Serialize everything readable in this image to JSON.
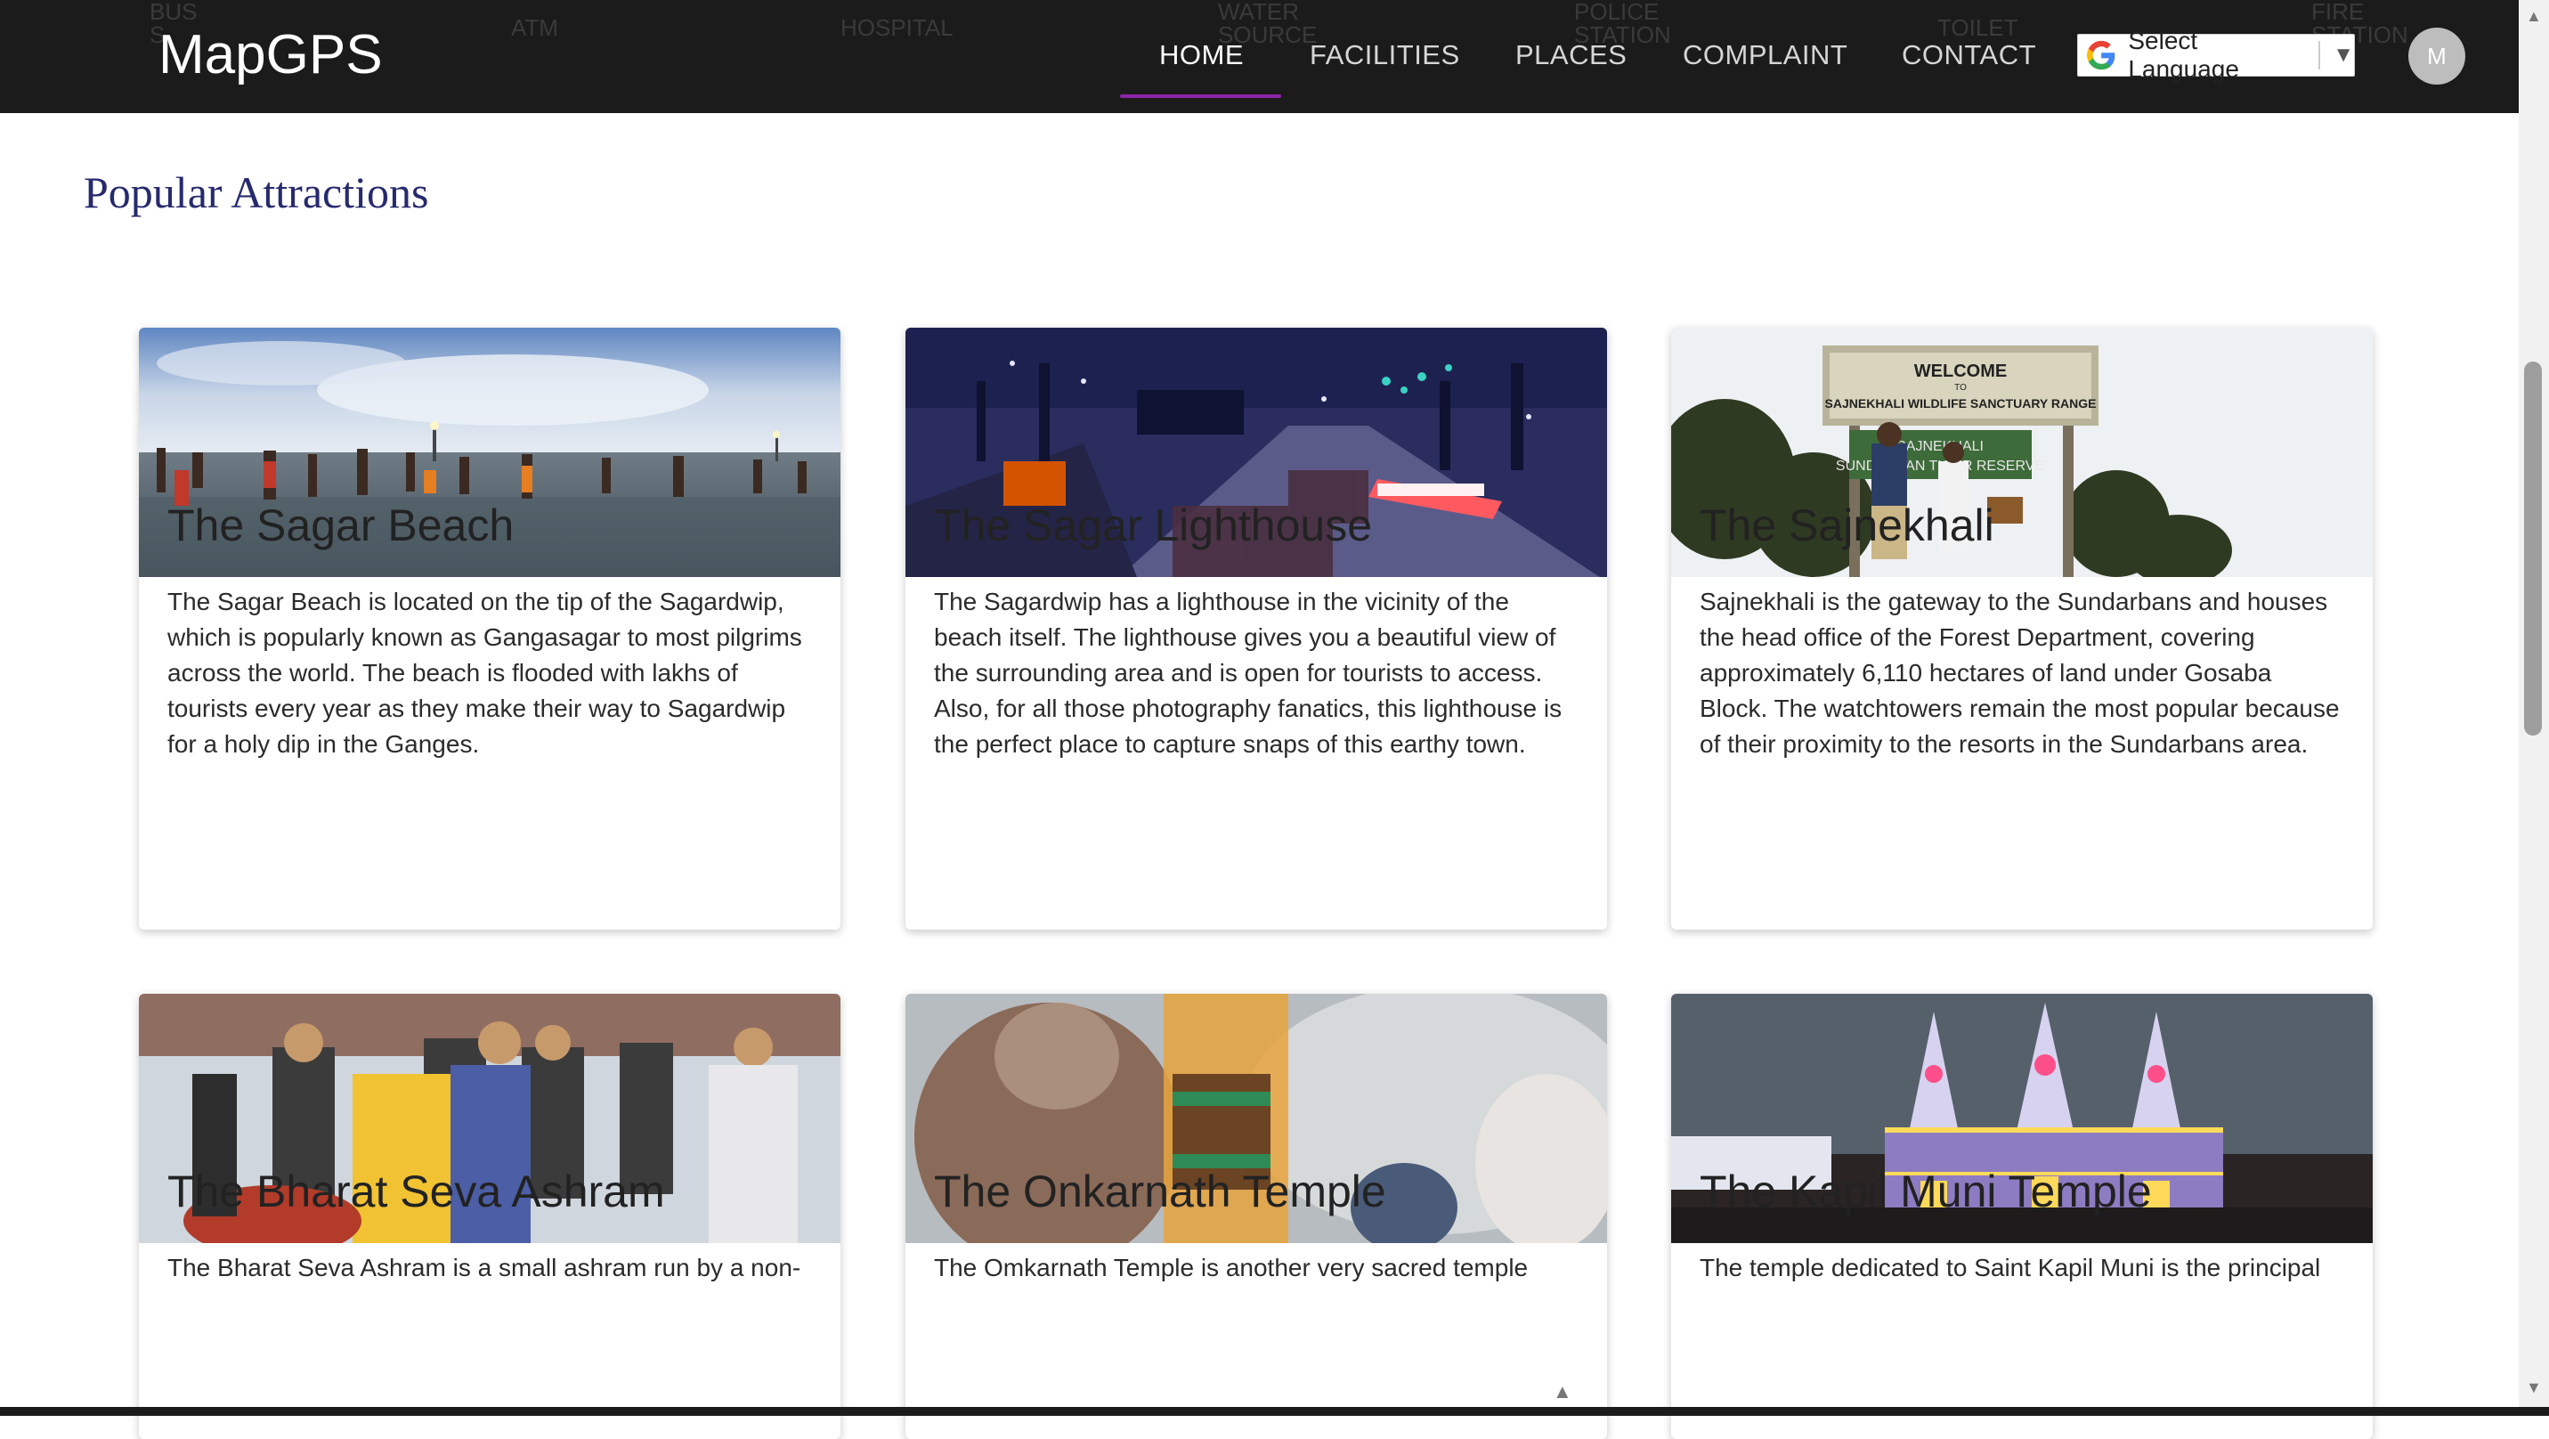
{
  "header": {
    "brand": "MapGPS",
    "ghost_items": [
      "BUS\nS",
      "ATM",
      "HOSPITAL",
      "WATER\nSOURCE",
      "POLICE\nSTATION",
      "TOILET",
      "FIRE\nSTATION"
    ],
    "nav": [
      {
        "label": "HOME",
        "active": true
      },
      {
        "label": "FACILITIES",
        "active": false
      },
      {
        "label": "PLACES",
        "active": false
      },
      {
        "label": "COMPLAINT",
        "active": false
      },
      {
        "label": "CONTACT",
        "active": false
      }
    ],
    "language_select": {
      "label": "Select Language",
      "arrow": "▼"
    },
    "avatar_initial": "M",
    "accent_color": "#8e24aa"
  },
  "main": {
    "section_title": "Popular Attractions",
    "cards": [
      {
        "title": "The Sagar Beach",
        "text": "The Sagar Beach is located on the tip of the Sagardwip, which is popularly known as Gangasagar to most pilgrims across the world. The beach is flooded with lakhs of tourists every year as they make their way to Sagardwip for a holy dip in the Ganges."
      },
      {
        "title": "The Sagar Lighthouse",
        "text": "The Sagardwip has a lighthouse in the vicinity of the beach itself. The lighthouse gives you a beautiful view of the surrounding area and is open for tourists to access. Also, for all those photography fanatics, this lighthouse is the perfect place to capture snaps of this earthy town."
      },
      {
        "title": "The Sajnekhali",
        "text": "Sajnekhali is the gateway to the Sundarbans and houses the head office of the Forest Department, covering approximately 6,110 hectares of land under Gosaba Block. The watchtowers remain the most popular because of their proximity to the resorts in the Sundarbans area.",
        "image_sign": {
          "line1": "WELCOME",
          "line2": "TO",
          "line3": "SAJNEKHALI WILDLIFE SANCTUARY RANGE",
          "line4": "SAJNEKHALI",
          "line5": "SUNDARBAN TIGER RESERVE"
        }
      },
      {
        "title": "The Bharat Seva Ashram",
        "text": "The Bharat Seva Ashram is a small ashram run by a non-"
      },
      {
        "title": "The Onkarnath Temple",
        "text": "The Omkarnath Temple is another very sacred temple"
      },
      {
        "title": "The Kapil Muni Temple",
        "text": "The temple dedicated to Saint Kapil Muni is the principal"
      }
    ]
  },
  "scroll": {
    "up": "▲",
    "down": "▼",
    "back_to_top": "▲"
  }
}
